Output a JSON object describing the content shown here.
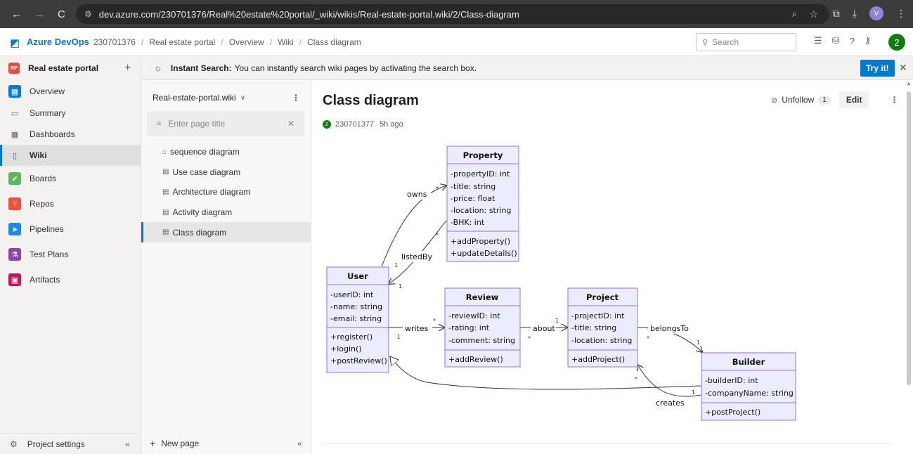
{
  "browser": {
    "url": "dev.azure.com/230701376/Real%20estate%20portal/_wiki/wikis/Real-estate-portal.wiki/2/Class-diagram",
    "profile_initial": "V"
  },
  "header": {
    "brand": "Azure DevOps",
    "org": "230701376",
    "breadcrumb": [
      "Real estate portal",
      "Overview",
      "Wiki",
      "Class diagram"
    ],
    "search_placeholder": "Search",
    "user_initial": "2"
  },
  "sidebar": {
    "project_badge": "RP",
    "project_name": "Real estate portal",
    "items": [
      {
        "label": "Overview",
        "icon": "overview-icon"
      },
      {
        "label": "Summary",
        "icon": "summary-icon"
      },
      {
        "label": "Dashboards",
        "icon": "dashboards-icon"
      },
      {
        "label": "Wiki",
        "icon": "wiki-icon"
      },
      {
        "label": "Boards",
        "icon": "boards-icon"
      },
      {
        "label": "Repos",
        "icon": "repos-icon"
      },
      {
        "label": "Pipelines",
        "icon": "pipelines-icon"
      },
      {
        "label": "Test Plans",
        "icon": "test-plans-icon"
      },
      {
        "label": "Artifacts",
        "icon": "artifacts-icon"
      }
    ],
    "footer_label": "Project settings"
  },
  "banner": {
    "title": "Instant Search:",
    "text": "You can instantly search wiki pages by activating the search box.",
    "button": "Try it!"
  },
  "wiki": {
    "name": "Real-estate-portal.wiki",
    "filter_placeholder": "Enter page title",
    "pages": [
      "sequence diagram",
      "Use case diagram",
      "Architecture diagram",
      "Activity diagram",
      "Class diagram"
    ],
    "new_page": "New page"
  },
  "page": {
    "title": "Class diagram",
    "author": "230701377",
    "author_initial": "2",
    "ago": "5h ago",
    "unfollow": "Unfollow",
    "follow_count": "1",
    "edit": "Edit"
  },
  "diagram": {
    "classes": {
      "property": {
        "name": "Property",
        "attrs": [
          "-propertyID: int",
          "-title: string",
          "-price: float",
          "-location: string",
          "-BHK: int"
        ],
        "ops": [
          "+addProperty()",
          "+updateDetails()"
        ]
      },
      "user": {
        "name": "User",
        "attrs": [
          "-userID: int",
          "-name: string",
          "-email: string"
        ],
        "ops": [
          "+register()",
          "+login()",
          "+postReview()"
        ]
      },
      "review": {
        "name": "Review",
        "attrs": [
          "-reviewID: int",
          "-rating: int",
          "-comment: string"
        ],
        "ops": [
          "+addReview()"
        ]
      },
      "project": {
        "name": "Project",
        "attrs": [
          "-projectID: int",
          "-title: string",
          "-location: string"
        ],
        "ops": [
          "+addProject()"
        ]
      },
      "builder": {
        "name": "Builder",
        "attrs": [
          "-builderID: int",
          "-companyName: string"
        ],
        "ops": [
          "+postProject()"
        ]
      }
    },
    "relations": {
      "owns": "owns",
      "listedBy": "listedBy",
      "writes": "writes",
      "about": "about",
      "belongsTo": "belongsTo",
      "creates": "creates"
    },
    "mult": {
      "one": "1",
      "many": "*"
    }
  }
}
